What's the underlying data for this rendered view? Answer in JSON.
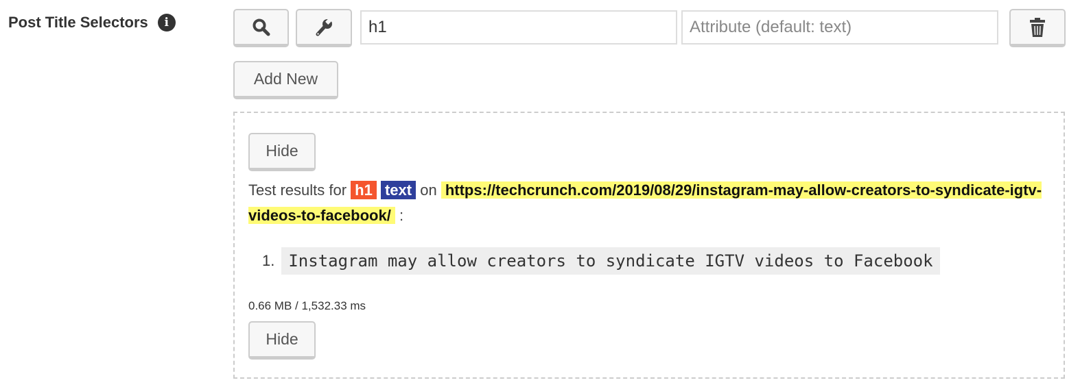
{
  "field": {
    "label": "Post Title Selectors",
    "info_icon": "info-icon"
  },
  "row": {
    "selector_value": "h1",
    "attribute_placeholder": "Attribute (default: text)"
  },
  "add_new_label": "Add New",
  "results": {
    "hide_label": "Hide",
    "prefix": "Test results for",
    "selector_tag": "h1",
    "attr_tag": "text",
    "on": "on",
    "url": "https://techcrunch.com/2019/08/29/instagram-may-allow-creators-to-syndicate-igtv-videos-to-facebook/",
    "suffix": ":",
    "items": [
      {
        "num": "1.",
        "text": "Instagram may allow creators to syndicate IGTV videos to Facebook"
      }
    ],
    "stats": "0.66 MB / 1,532.33 ms"
  },
  "colors": {
    "selector_tag": "#f4552e",
    "attr_tag": "#2e3f9c",
    "url_highlight": "#fffb76"
  }
}
